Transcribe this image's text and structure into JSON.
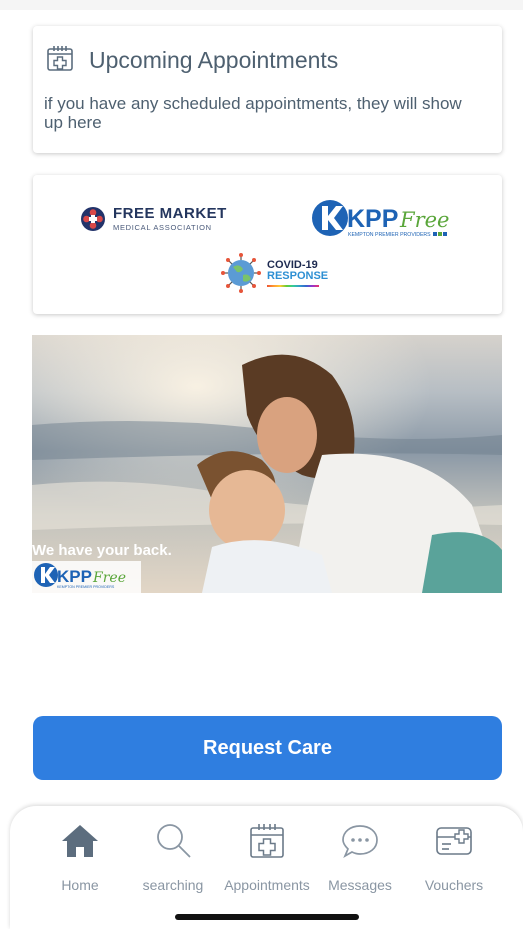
{
  "appointments": {
    "title": "Upcoming Appointments",
    "description": "if you have any scheduled appointments, they will show up here",
    "icon": "calendar-plus-icon"
  },
  "logos": {
    "fmma_line1": "FREE MARKET",
    "fmma_line2": "MEDICAL ASSOCIATION",
    "kpp_name": "KPP",
    "kpp_free": "Free",
    "kpp_sub": "KEMPTON PREMIER PROVIDERS",
    "covid_line1": "COVID-19",
    "covid_line2": "RESPONSE"
  },
  "banner": {
    "tagline": "We have your back.",
    "logo_name": "KPP",
    "logo_free": "Free",
    "logo_sub": "KEMPTON PREMIER PROVIDERS"
  },
  "request_button": {
    "label": "Request Care"
  },
  "tabs": [
    {
      "label": "Home",
      "icon": "home-icon",
      "active": true
    },
    {
      "label": "searching",
      "icon": "search-icon"
    },
    {
      "label": "Appointments",
      "icon": "calendar-plus-icon"
    },
    {
      "label": "Messages",
      "icon": "chat-bubble-icon"
    },
    {
      "label": "Vouchers",
      "icon": "voucher-card-icon"
    }
  ],
  "colors": {
    "accent": "#2f7ee0",
    "tab_active": "#5c6d7e",
    "tab_inactive": "#8a96a3",
    "kpp_blue": "#1e63b5",
    "kpp_green": "#5aa63a"
  }
}
